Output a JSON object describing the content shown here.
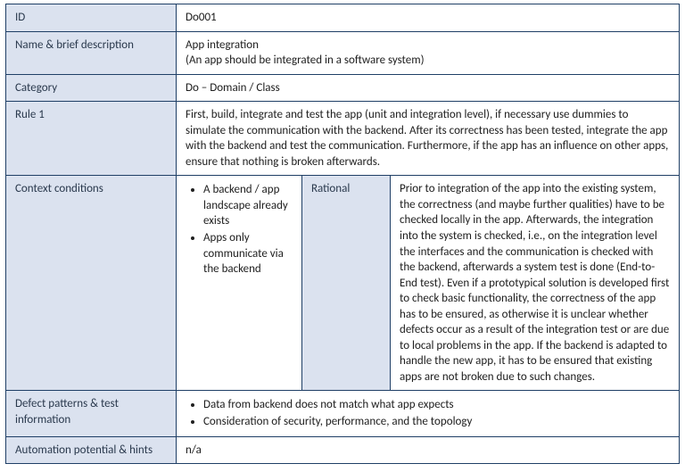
{
  "labels": {
    "id": "ID",
    "name_desc": "Name & brief description",
    "category": "Category",
    "rule1": "Rule 1",
    "context": "Context conditions",
    "rational": "Rational",
    "defect": "Defect patterns & test information",
    "automation": "Automation potential & hints"
  },
  "values": {
    "id": "Do001",
    "name": "App integration",
    "name_paren": "(An app should be integrated in a software system)",
    "category": "Do – Domain / Class",
    "rule1": "First, build, integrate and test the app (unit and integration level), if necessary use dummies to simulate the communication with the backend. After its correctness has been tested, integrate the app with the backend and test the communication. Furthermore, if the app has an influence on other apps, ensure that nothing is broken afterwards.",
    "context_items": [
      "A backend / app landscape already exists",
      "Apps only communicate via the backend"
    ],
    "rational": "Prior to integration of the app into the existing system, the correctness (and maybe further qualities) have to be checked locally in the app. Afterwards, the integration into the system is checked, i.e., on the integration level the interfaces and the communication is checked with the backend, afterwards a system test is done (End-to-End test). Even if a prototypical solution is developed first to check basic functionality, the correctness of the app has to be ensured, as otherwise it is unclear whether defects occur as a result of the integration test or are due to local problems in the app. If the backend is adapted to handle the new app, it has to be ensured that existing apps are not broken due to such changes.",
    "defect_items": [
      "Data from backend does not match what app expects",
      "Consideration of security, performance, and the topology"
    ],
    "automation": "n/a"
  }
}
